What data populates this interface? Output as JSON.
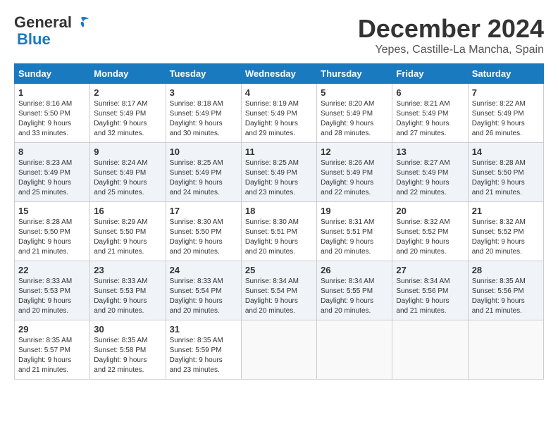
{
  "header": {
    "logo_general": "General",
    "logo_blue": "Blue",
    "title": "December 2024",
    "location": "Yepes, Castille-La Mancha, Spain"
  },
  "weekdays": [
    "Sunday",
    "Monday",
    "Tuesday",
    "Wednesday",
    "Thursday",
    "Friday",
    "Saturday"
  ],
  "weeks": [
    [
      {
        "day": "1",
        "info": "Sunrise: 8:16 AM\nSunset: 5:50 PM\nDaylight: 9 hours\nand 33 minutes."
      },
      {
        "day": "2",
        "info": "Sunrise: 8:17 AM\nSunset: 5:49 PM\nDaylight: 9 hours\nand 32 minutes."
      },
      {
        "day": "3",
        "info": "Sunrise: 8:18 AM\nSunset: 5:49 PM\nDaylight: 9 hours\nand 30 minutes."
      },
      {
        "day": "4",
        "info": "Sunrise: 8:19 AM\nSunset: 5:49 PM\nDaylight: 9 hours\nand 29 minutes."
      },
      {
        "day": "5",
        "info": "Sunrise: 8:20 AM\nSunset: 5:49 PM\nDaylight: 9 hours\nand 28 minutes."
      },
      {
        "day": "6",
        "info": "Sunrise: 8:21 AM\nSunset: 5:49 PM\nDaylight: 9 hours\nand 27 minutes."
      },
      {
        "day": "7",
        "info": "Sunrise: 8:22 AM\nSunset: 5:49 PM\nDaylight: 9 hours\nand 26 minutes."
      }
    ],
    [
      {
        "day": "8",
        "info": "Sunrise: 8:23 AM\nSunset: 5:49 PM\nDaylight: 9 hours\nand 25 minutes."
      },
      {
        "day": "9",
        "info": "Sunrise: 8:24 AM\nSunset: 5:49 PM\nDaylight: 9 hours\nand 25 minutes."
      },
      {
        "day": "10",
        "info": "Sunrise: 8:25 AM\nSunset: 5:49 PM\nDaylight: 9 hours\nand 24 minutes."
      },
      {
        "day": "11",
        "info": "Sunrise: 8:25 AM\nSunset: 5:49 PM\nDaylight: 9 hours\nand 23 minutes."
      },
      {
        "day": "12",
        "info": "Sunrise: 8:26 AM\nSunset: 5:49 PM\nDaylight: 9 hours\nand 22 minutes."
      },
      {
        "day": "13",
        "info": "Sunrise: 8:27 AM\nSunset: 5:49 PM\nDaylight: 9 hours\nand 22 minutes."
      },
      {
        "day": "14",
        "info": "Sunrise: 8:28 AM\nSunset: 5:50 PM\nDaylight: 9 hours\nand 21 minutes."
      }
    ],
    [
      {
        "day": "15",
        "info": "Sunrise: 8:28 AM\nSunset: 5:50 PM\nDaylight: 9 hours\nand 21 minutes."
      },
      {
        "day": "16",
        "info": "Sunrise: 8:29 AM\nSunset: 5:50 PM\nDaylight: 9 hours\nand 21 minutes."
      },
      {
        "day": "17",
        "info": "Sunrise: 8:30 AM\nSunset: 5:50 PM\nDaylight: 9 hours\nand 20 minutes."
      },
      {
        "day": "18",
        "info": "Sunrise: 8:30 AM\nSunset: 5:51 PM\nDaylight: 9 hours\nand 20 minutes."
      },
      {
        "day": "19",
        "info": "Sunrise: 8:31 AM\nSunset: 5:51 PM\nDaylight: 9 hours\nand 20 minutes."
      },
      {
        "day": "20",
        "info": "Sunrise: 8:32 AM\nSunset: 5:52 PM\nDaylight: 9 hours\nand 20 minutes."
      },
      {
        "day": "21",
        "info": "Sunrise: 8:32 AM\nSunset: 5:52 PM\nDaylight: 9 hours\nand 20 minutes."
      }
    ],
    [
      {
        "day": "22",
        "info": "Sunrise: 8:33 AM\nSunset: 5:53 PM\nDaylight: 9 hours\nand 20 minutes."
      },
      {
        "day": "23",
        "info": "Sunrise: 8:33 AM\nSunset: 5:53 PM\nDaylight: 9 hours\nand 20 minutes."
      },
      {
        "day": "24",
        "info": "Sunrise: 8:33 AM\nSunset: 5:54 PM\nDaylight: 9 hours\nand 20 minutes."
      },
      {
        "day": "25",
        "info": "Sunrise: 8:34 AM\nSunset: 5:54 PM\nDaylight: 9 hours\nand 20 minutes."
      },
      {
        "day": "26",
        "info": "Sunrise: 8:34 AM\nSunset: 5:55 PM\nDaylight: 9 hours\nand 20 minutes."
      },
      {
        "day": "27",
        "info": "Sunrise: 8:34 AM\nSunset: 5:56 PM\nDaylight: 9 hours\nand 21 minutes."
      },
      {
        "day": "28",
        "info": "Sunrise: 8:35 AM\nSunset: 5:56 PM\nDaylight: 9 hours\nand 21 minutes."
      }
    ],
    [
      {
        "day": "29",
        "info": "Sunrise: 8:35 AM\nSunset: 5:57 PM\nDaylight: 9 hours\nand 21 minutes."
      },
      {
        "day": "30",
        "info": "Sunrise: 8:35 AM\nSunset: 5:58 PM\nDaylight: 9 hours\nand 22 minutes."
      },
      {
        "day": "31",
        "info": "Sunrise: 8:35 AM\nSunset: 5:59 PM\nDaylight: 9 hours\nand 23 minutes."
      },
      {
        "day": "",
        "info": ""
      },
      {
        "day": "",
        "info": ""
      },
      {
        "day": "",
        "info": ""
      },
      {
        "day": "",
        "info": ""
      }
    ]
  ]
}
